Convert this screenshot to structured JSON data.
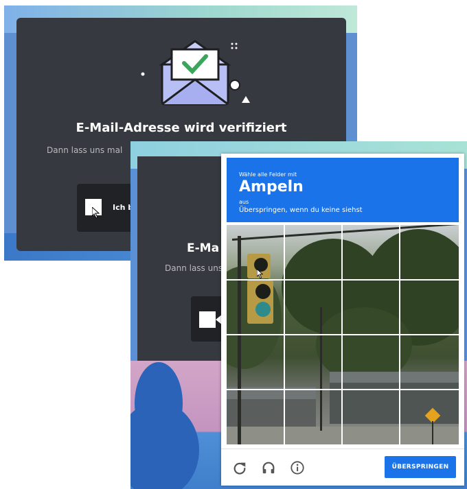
{
  "background_dialog": {
    "title": "E-Mail-Adresse wird verifiziert",
    "subtitle": "Dann lass uns mal",
    "checkbox_label": "Ich b",
    "title_cropped": "E-Ma",
    "subtitle_cropped": "Dann lass uns"
  },
  "captcha": {
    "instruction": "Wähle alle Felder mit",
    "object": "Ampeln",
    "small": "aus",
    "skip_hint": "Überspringen, wenn du keine siehst",
    "grid": {
      "rows": 4,
      "cols": 4
    },
    "skip_button": "ÜBERSPRINGEN",
    "icons": [
      "reload-icon",
      "audio-headphones-icon",
      "info-icon"
    ]
  },
  "colors": {
    "discord_card": "#36393f",
    "captcha_blue": "#1a73e8"
  }
}
